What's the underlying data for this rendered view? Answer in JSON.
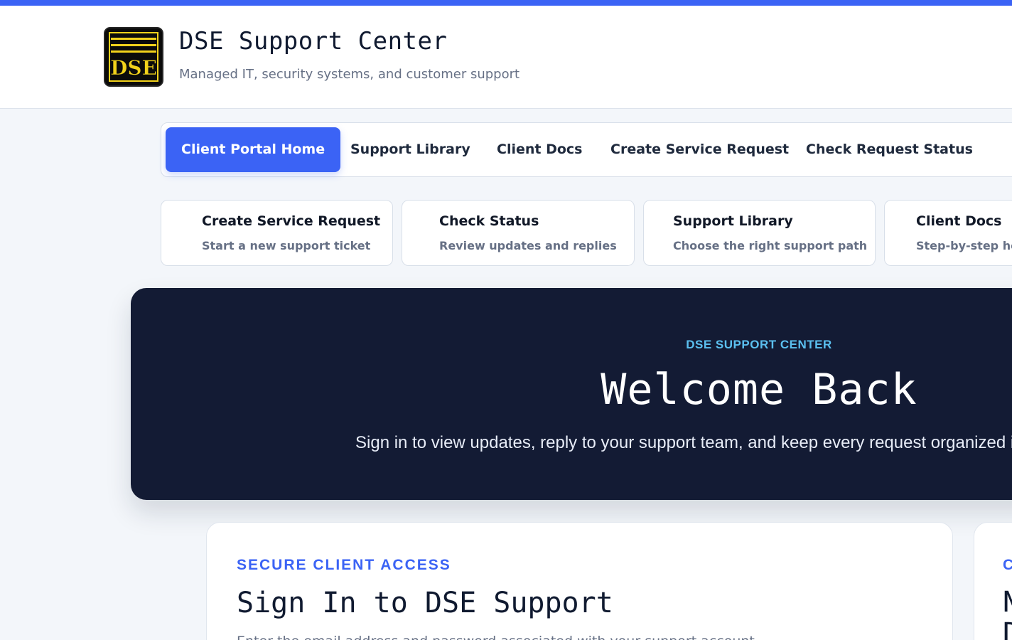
{
  "header": {
    "logo_text": "DSE",
    "title": "DSE Support Center",
    "subtitle": "Managed IT, security systems, and customer support"
  },
  "nav": {
    "items": [
      {
        "label": "Client Portal Home",
        "active": true
      },
      {
        "label": "Support Library",
        "active": false
      },
      {
        "label": "Client Docs",
        "active": false
      },
      {
        "label": "Create Service Request",
        "active": false
      },
      {
        "label": "Check Request Status",
        "active": false
      }
    ]
  },
  "quick_links": [
    {
      "title": "Create Service Request",
      "subtitle": "Start a new support ticket"
    },
    {
      "title": "Check Status",
      "subtitle": "Review updates and replies"
    },
    {
      "title": "Support Library",
      "subtitle": "Choose the right support path"
    },
    {
      "title": "Client Docs",
      "subtitle": "Step-by-step help"
    }
  ],
  "hero": {
    "eyebrow": "DSE SUPPORT CENTER",
    "title": "Welcome Back",
    "subtitle": "Sign in to view updates, reply to your support team, and keep every request organized in one place."
  },
  "signin_card": {
    "eyebrow": "SECURE CLIENT ACCESS",
    "title": "Sign In to DSE Support",
    "description": "Enter the email address and password associated with your support account."
  },
  "side_card": {
    "eyebrow": "C",
    "title": "N\nD"
  },
  "colors": {
    "accent": "#3b63f5",
    "hero_bg": "#131b34",
    "hero_eyebrow": "#5bc0f0",
    "logo_gold": "#f2d21b"
  }
}
